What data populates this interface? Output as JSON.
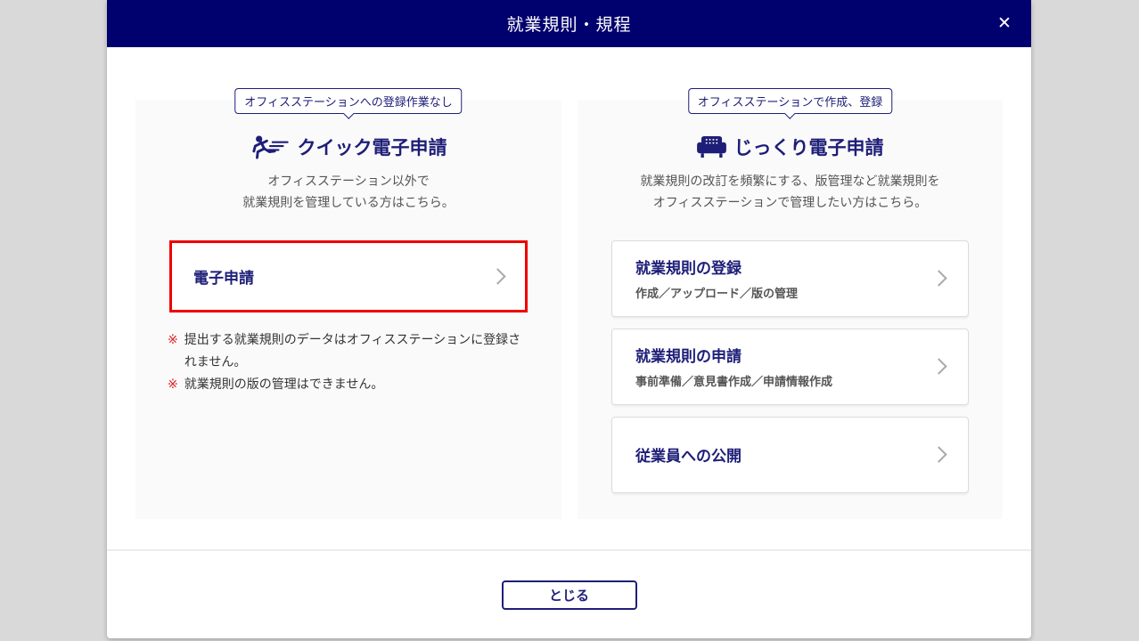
{
  "header": {
    "title": "就業規則・規程",
    "close_icon": "✕"
  },
  "left_panel": {
    "badge": "オフィスステーションへの登録作業なし",
    "title": "クイック電子申請",
    "icon": "runner-icon",
    "description_line1": "オフィスステーション以外で",
    "description_line2": "就業規則を管理している方はこちら。",
    "button": {
      "label": "電子申請",
      "highlighted": true,
      "highlight_color": "#ee0000"
    },
    "note_marker": "※",
    "notes": [
      {
        "text": "提出する就業規則のデータはオフィスステーションに登録されません。"
      },
      {
        "text": "就業規則の版の管理はできません。"
      }
    ]
  },
  "right_panel": {
    "badge": "オフィスステーションで作成、登録",
    "title": "じっくり電子申請",
    "icon": "sofa-icon",
    "description_line1": "就業規則の改訂を頻繁にする、版管理など就業規則を",
    "description_line2": "オフィスステーションで管理したい方はこちら。",
    "buttons": [
      {
        "label": "就業規則の登録",
        "sublabel": "作成／アップロード／版の管理"
      },
      {
        "label": "就業規則の申請",
        "sublabel": "事前準備／意見書作成／申請情報作成"
      },
      {
        "label": "従業員への公開",
        "sublabel": ""
      }
    ]
  },
  "footer": {
    "close_label": "とじる"
  },
  "colors": {
    "header_bg": "#00006e",
    "accent_navy": "#1e1e78",
    "highlight_red": "#ee0000",
    "panel_bg": "#fafafa",
    "page_bg": "#d9d9d9"
  }
}
